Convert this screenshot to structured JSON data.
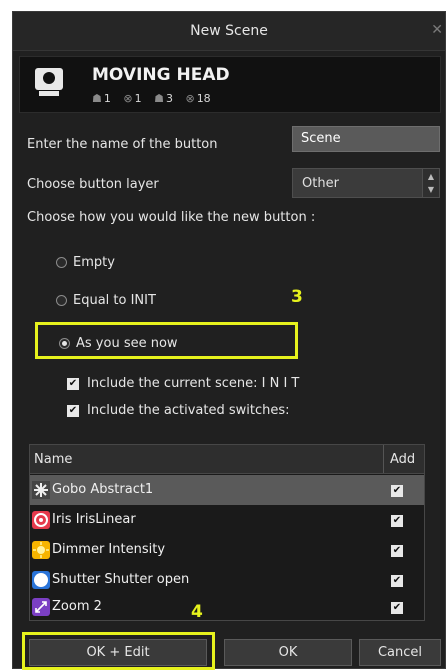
{
  "window": {
    "title": "New Scene",
    "close_glyph": "✕"
  },
  "fixture": {
    "name": "MOVING HEAD",
    "stats": [
      {
        "icon": "moving-head-icon",
        "value": "1"
      },
      {
        "icon": "fixture-target-icon",
        "value": "1"
      },
      {
        "icon": "moving-head-icon",
        "value": "3"
      },
      {
        "icon": "fixture-target-icon",
        "value": "18"
      }
    ]
  },
  "form": {
    "name_label": "Enter the name of the button",
    "name_value": "Scene",
    "layer_label": "Choose button layer",
    "layer_value": "Other",
    "how_label": "Choose how you would like the new button :"
  },
  "options": {
    "empty": "Empty",
    "equal_init": "Equal to INIT",
    "as_you_see": "As you see now",
    "selected": "as_you_see"
  },
  "checks": {
    "include_scene": "Include the current scene: I N I T",
    "include_switches": "Include the activated switches:"
  },
  "annotations": {
    "three": "3",
    "four": "4"
  },
  "table": {
    "headers": {
      "name": "Name",
      "add": "Add"
    },
    "rows": [
      {
        "name": "Gobo Abstract1",
        "checked": true,
        "selected": true,
        "icon": "gobo-icon"
      },
      {
        "name": "Iris IrisLinear",
        "checked": true,
        "selected": false,
        "icon": "iris-icon"
      },
      {
        "name": "Dimmer Intensity",
        "checked": true,
        "selected": false,
        "icon": "dimmer-icon"
      },
      {
        "name": "Shutter Shutter open",
        "checked": true,
        "selected": false,
        "icon": "shutter-icon"
      },
      {
        "name": "Zoom  2",
        "checked": true,
        "selected": false,
        "icon": "zoom-icon"
      }
    ]
  },
  "buttons": {
    "ok_edit": "OK + Edit",
    "ok": "OK",
    "cancel": "Cancel"
  },
  "colors": {
    "highlight": "#e6f21d",
    "dialog_bg": "#202020"
  }
}
